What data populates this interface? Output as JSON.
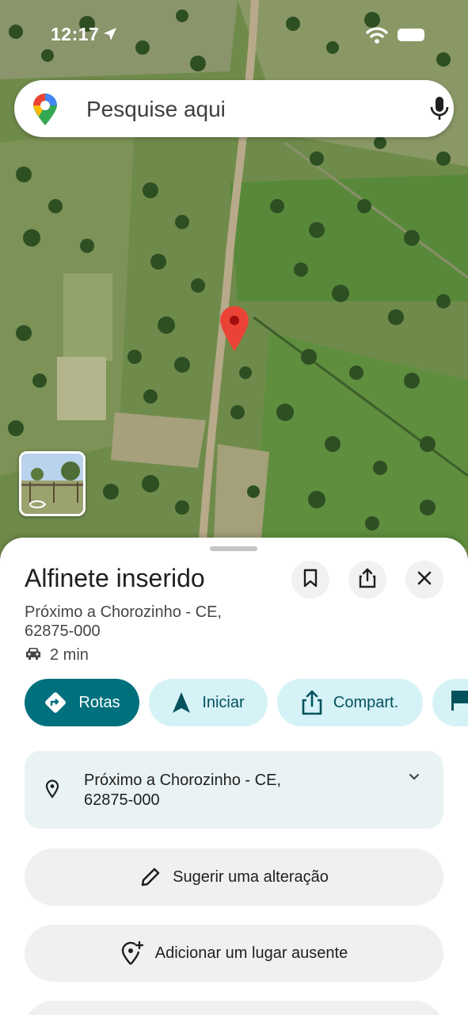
{
  "status_bar": {
    "time": "12:17"
  },
  "search": {
    "placeholder": "Pesquise aqui"
  },
  "place": {
    "title": "Alfinete inserido",
    "address_line1": "Próximo a Chorozinho - CE,",
    "address_line2": "62875-000",
    "drive_time": "2 min"
  },
  "actions": {
    "directions": "Rotas",
    "start": "Iniciar",
    "share": "Compart."
  },
  "address_card": {
    "line1": "Próximo a Chorozinho - CE,",
    "line2": "62875-000"
  },
  "options": {
    "suggest_edit": "Sugerir uma alteração",
    "add_missing_place": "Adicionar um lugar ausente"
  },
  "colors": {
    "accent": "#00707c",
    "chip_bg": "#d5f2f7",
    "pin_red": "#ea4335"
  },
  "icons": {
    "location_arrow": "location-arrow-icon",
    "wifi": "wifi-icon",
    "battery": "battery-icon",
    "maps_logo": "google-maps-logo-icon",
    "mic": "microphone-icon",
    "pin": "red-map-pin-icon",
    "bookmark": "bookmark-icon",
    "share": "share-icon",
    "close": "close-icon",
    "car": "car-icon",
    "directions": "directions-icon",
    "navigation": "navigation-arrow-icon",
    "flag": "flag-icon",
    "place": "place-icon",
    "chevron": "chevron-down-icon",
    "pencil": "pencil-icon",
    "add_place": "add-place-icon"
  }
}
